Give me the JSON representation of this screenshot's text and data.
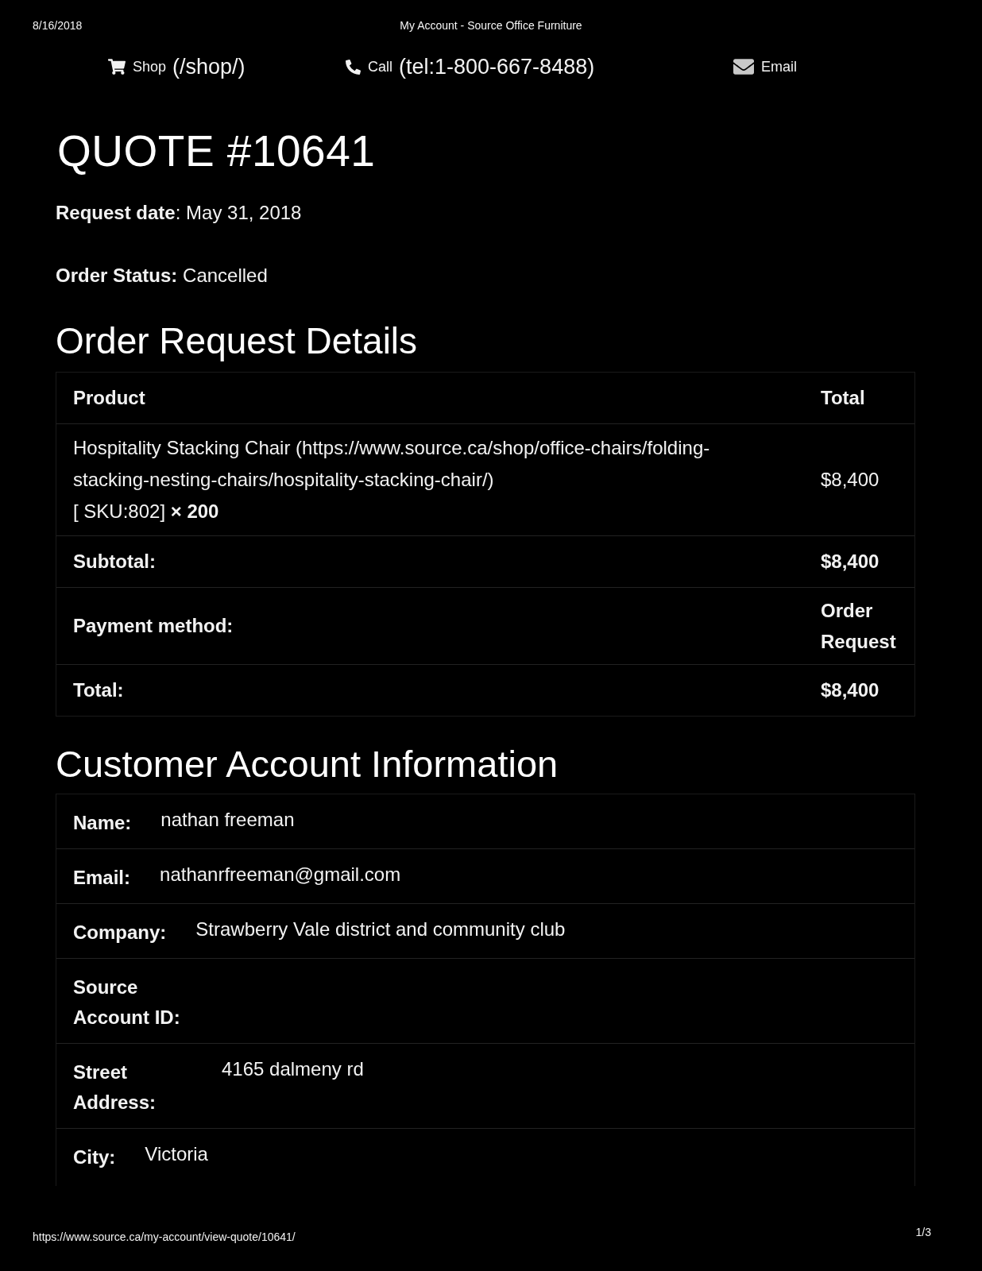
{
  "print_header": {
    "date": "8/16/2018",
    "title": "My Account - Source Office Furniture"
  },
  "nav": [
    {
      "kind": "shop",
      "label": "Shop",
      "url": "(/shop/)"
    },
    {
      "kind": "call",
      "label": "Call",
      "url": "(tel:1-800-667-8488)"
    },
    {
      "kind": "email",
      "label": "Email"
    }
  ],
  "quote": {
    "title": "QUOTE #10641",
    "meta": [
      "**Request date**: May 31, 2018",
      "**Order Status:** Cancelled"
    ]
  },
  "order_details": {
    "heading": "Order Request Details",
    "columns": [
      "Product",
      "Total"
    ],
    "items": [
      {
        "product": "Hospitality Stacking Chair (https://www.source.ca/shop/office-chairs/folding-stacking-nesting-chairs/hospitality-stacking-chair/)",
        "sku_quantity": "[ SKU:802] **× 200**",
        "total": "$8,400"
      }
    ],
    "totals": [
      {
        "label": "Subtotal:",
        "value": "$8,400"
      },
      {
        "label": "Payment method:",
        "value": "Order Request"
      },
      {
        "label": "Total:",
        "value": "$8,400"
      }
    ]
  },
  "customer": {
    "heading": "Customer Account Information",
    "fields": [
      {
        "label": "Name:",
        "value": "nathan freeman"
      },
      {
        "label": "Email:",
        "value": "nathanrfreeman@gmail.com"
      },
      {
        "label": "Company:",
        "value": "Strawberry Vale district and community club"
      },
      {
        "label": "Source Account ID:"
      },
      {
        "label": "Street Address:",
        "value": "4165 dalmeny rd"
      },
      {
        "label": "City:",
        "value": "Victoria"
      }
    ]
  },
  "print_footer": {
    "url": "https://www.source.ca/my-account/view-quote/10641/",
    "page": "1/3"
  }
}
